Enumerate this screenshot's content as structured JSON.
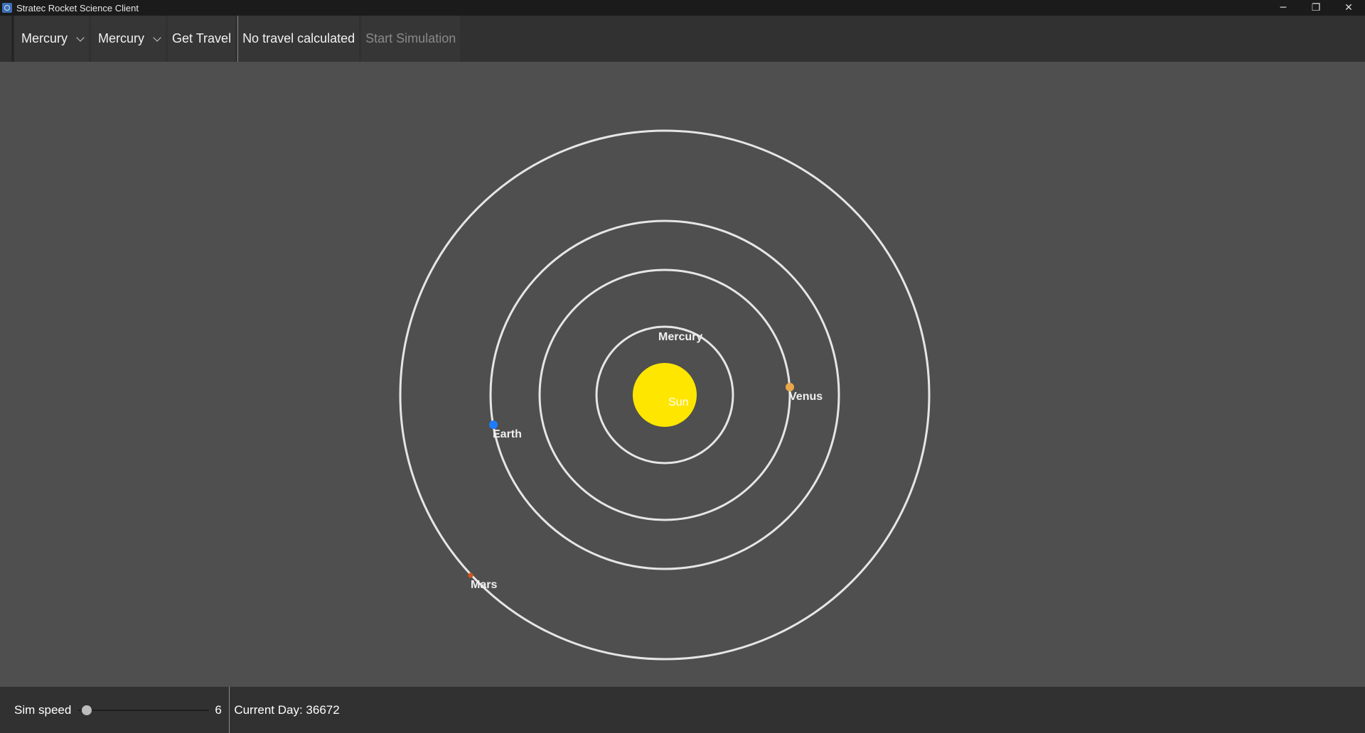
{
  "window": {
    "title": "Stratec Rocket Science Client",
    "controls": {
      "minimize": "─",
      "maximize": "❐",
      "close": "✕"
    }
  },
  "toolbar": {
    "origin_planet": "Mercury",
    "destination_planet": "Mercury",
    "get_travel_label": "Get Travel",
    "travel_status": "No travel calculated",
    "start_simulation_label": "Start Simulation"
  },
  "solar_system": {
    "sun": {
      "label": "Sun",
      "color": "#ffe600"
    },
    "orbit_color": "#e6e6e6",
    "planets": [
      {
        "label": "Mercury",
        "color": "#cccccc"
      },
      {
        "label": "Venus",
        "color": "#e8a84a"
      },
      {
        "label": "Earth",
        "color": "#1e7bff"
      },
      {
        "label": "Mars",
        "color": "#d4531a"
      }
    ]
  },
  "bottombar": {
    "sim_speed_label": "Sim speed",
    "sim_speed_value": "6",
    "sim_speed_fraction": 0.03,
    "current_day_label": "Current Day: 36672"
  }
}
